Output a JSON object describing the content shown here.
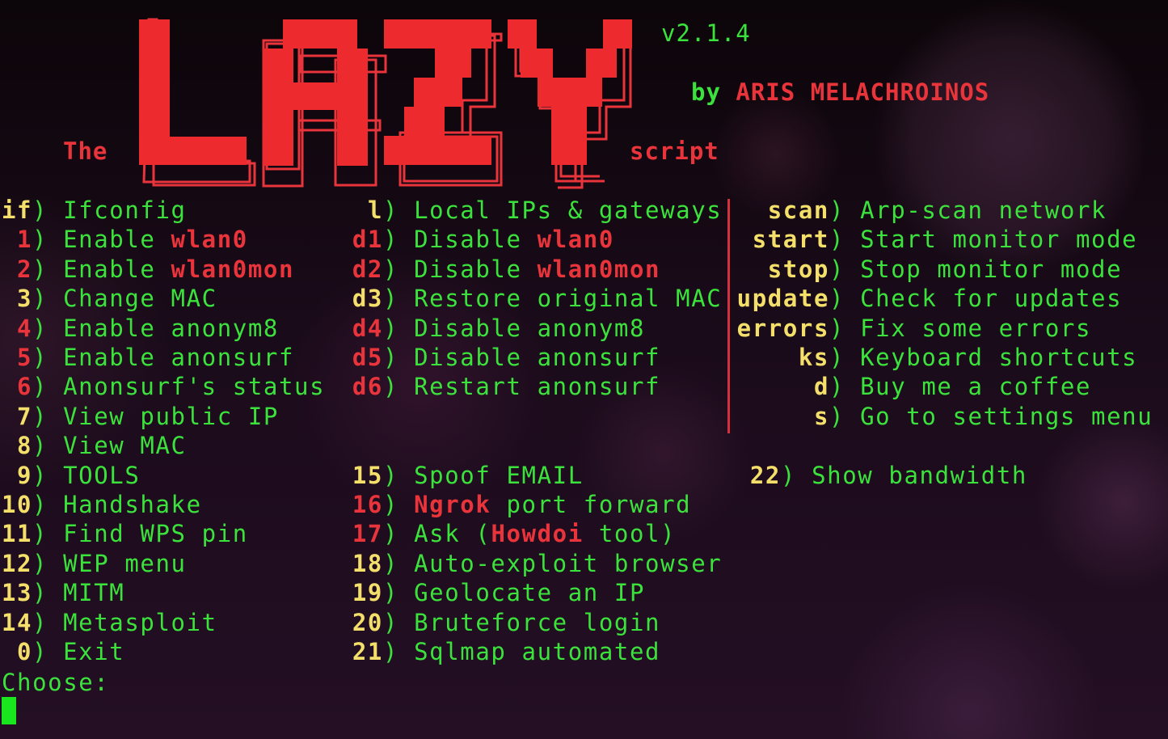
{
  "header": {
    "prefix": "The",
    "title": "LAZY",
    "suffix": "script",
    "version": "v2.1.4",
    "by_label": "by",
    "author": "ARIS MELACHROINOS"
  },
  "colors": {
    "key_yellow": "#f3df6a",
    "key_red": "#e8343a",
    "text_green": "#3ce23c",
    "separator": "#d6303a",
    "cursor": "#19e61f"
  },
  "menu": {
    "col1": [
      {
        "key": "if",
        "key_color": "yellow",
        "label": "Ifconfig"
      },
      {
        "key": "1",
        "key_color": "red",
        "label": "Enable ",
        "highlight": "wlan0"
      },
      {
        "key": "2",
        "key_color": "red",
        "label": "Enable ",
        "highlight": "wlan0mon"
      },
      {
        "key": "3",
        "key_color": "yellow",
        "label": "Change MAC"
      },
      {
        "key": "4",
        "key_color": "red",
        "label": "Enable anonym8"
      },
      {
        "key": "5",
        "key_color": "red",
        "label": "Enable anonsurf"
      },
      {
        "key": "6",
        "key_color": "red",
        "label": "Anonsurf's status"
      },
      {
        "key": "7",
        "key_color": "yellow",
        "label": "View public IP"
      },
      {
        "key": "8",
        "key_color": "yellow",
        "label": "View MAC"
      },
      {
        "key": "9",
        "key_color": "yellow",
        "label": "TOOLS"
      },
      {
        "key": "10",
        "key_color": "yellow",
        "label": "Handshake"
      },
      {
        "key": "11",
        "key_color": "yellow",
        "label": "Find WPS pin"
      },
      {
        "key": "12",
        "key_color": "yellow",
        "label": "WEP menu"
      },
      {
        "key": "13",
        "key_color": "yellow",
        "label": "MITM"
      },
      {
        "key": "14",
        "key_color": "yellow",
        "label": "Metasploit"
      },
      {
        "key": "0",
        "key_color": "yellow",
        "label": "Exit"
      }
    ],
    "col2_top": [
      {
        "key": "l",
        "key_color": "yellow",
        "label": "Local IPs & gateways"
      },
      {
        "key": "d1",
        "key_color": "red",
        "label": "Disable ",
        "highlight": "wlan0"
      },
      {
        "key": "d2",
        "key_color": "red",
        "label": "Disable ",
        "highlight": "wlan0mon"
      },
      {
        "key": "d3",
        "key_color": "yellow",
        "label": "Restore original MAC"
      },
      {
        "key": "d4",
        "key_color": "red",
        "label": "Disable anonym8"
      },
      {
        "key": "d5",
        "key_color": "red",
        "label": "Disable anonsurf"
      },
      {
        "key": "d6",
        "key_color": "red",
        "label": "Restart anonsurf"
      }
    ],
    "col2_bottom": [
      {
        "key": "15",
        "key_color": "yellow",
        "label": "Spoof EMAIL"
      },
      {
        "key": "16",
        "key_color": "red",
        "highlight_first": "Ngrok",
        "label": " port forward"
      },
      {
        "key": "17",
        "key_color": "red",
        "label": "Ask (",
        "highlight": "Howdoi",
        "label_after": " tool)"
      },
      {
        "key": "18",
        "key_color": "yellow",
        "label": "Auto-exploit browser"
      },
      {
        "key": "19",
        "key_color": "yellow",
        "label": "Geolocate an IP"
      },
      {
        "key": "20",
        "key_color": "yellow",
        "label": "Bruteforce login"
      },
      {
        "key": "21",
        "key_color": "yellow",
        "label": "Sqlmap automated"
      }
    ],
    "col3": [
      {
        "key": "scan",
        "key_color": "yellow",
        "label": "Arp-scan network"
      },
      {
        "key": "start",
        "key_color": "yellow",
        "label": "Start monitor mode"
      },
      {
        "key": "stop",
        "key_color": "yellow",
        "label": "Stop monitor mode"
      },
      {
        "key": "update",
        "key_color": "yellow",
        "label": "Check for updates"
      },
      {
        "key": "errors",
        "key_color": "yellow",
        "label": "Fix some errors"
      },
      {
        "key": "ks",
        "key_color": "yellow",
        "label": "Keyboard shortcuts"
      },
      {
        "key": "d",
        "key_color": "yellow",
        "label": "Buy me a coffee"
      },
      {
        "key": "s",
        "key_color": "yellow",
        "label": "Go to settings menu"
      }
    ],
    "col3_bottom": [
      {
        "key": "22",
        "key_color": "yellow",
        "label": "Show bandwidth"
      }
    ]
  },
  "prompt": {
    "label": "Choose:",
    "input_value": ""
  }
}
